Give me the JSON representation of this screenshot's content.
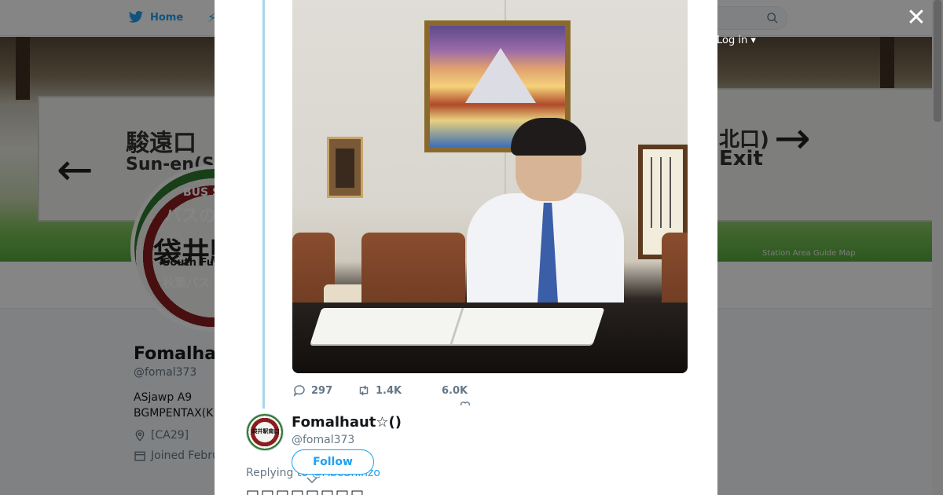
{
  "topnav": {
    "home_label": "Home",
    "login_label": "Log in ▾"
  },
  "banner": {
    "sign_left_jp": "駿遠口",
    "sign_left_en": "Sun-en(S",
    "sign_right_jp": "北口)",
    "sign_right_en": "Exit",
    "caption": "Station Area Guide Map"
  },
  "profile_avatar": {
    "line1": "BUS S",
    "line2": "バスの",
    "line3": "袋井駅",
    "line4": "South Fuk",
    "line5": "秋葉バス"
  },
  "profile": {
    "name": "Fomalhau",
    "handle": "@fomal373",
    "bio_line1": "ASjawp A9",
    "bio_line2": "BGMPENTAX(K",
    "location": "[CA29]",
    "joined": "Joined Febru"
  },
  "tweet": {
    "reply_count": "297",
    "retweet_count": "1.4K",
    "like_count": "6.0K"
  },
  "reply": {
    "avatar_text": "袋井駅南口",
    "name": "Fomalhaut☆()",
    "handle": "@fomal373",
    "follow_label": "Follow",
    "replying_prefix": "Replying to ",
    "replying_mention": "@AbeShinzo",
    "text": "□□□□□□□□"
  },
  "colors": {
    "accent": "#1da1f2",
    "thread_line": "#a8d6e9",
    "muted_text": "#657786"
  }
}
